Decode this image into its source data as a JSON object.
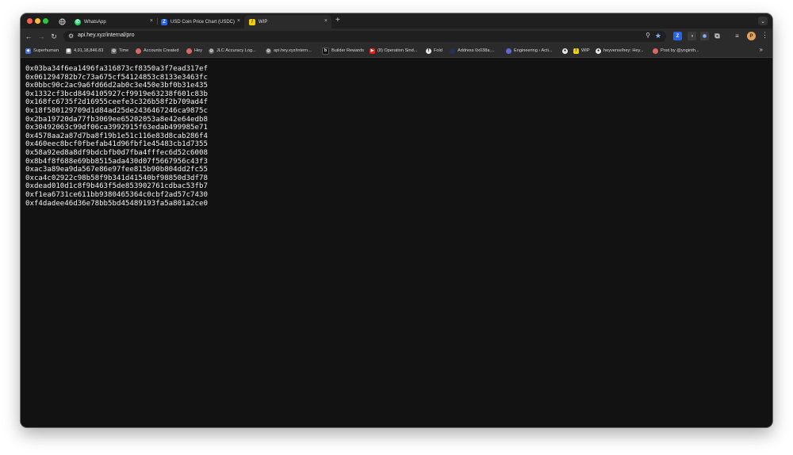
{
  "window": {
    "tabs": [
      {
        "label": "WhatsApp",
        "icon": "whatsapp-icon",
        "color": "#25d366",
        "active": false
      },
      {
        "label": "USD Coin Price Chart (USDC)",
        "icon": "zerion-icon",
        "color": "#2962ef",
        "active": false
      },
      {
        "label": "WIP",
        "icon": "notion-wip-icon",
        "color": "#f5d000",
        "active": true
      }
    ],
    "close_glyph": "×",
    "new_tab_glyph": "+"
  },
  "toolbar": {
    "url": "api.hey.xyz/internal/pro",
    "avatar_letter": "P"
  },
  "bookmarks": [
    {
      "label": "Superhuman",
      "icon": "superhuman-icon"
    },
    {
      "label": "4,91,18,846.83",
      "icon": "sheet-icon"
    },
    {
      "label": "Time",
      "icon": "globe-icon"
    },
    {
      "label": "Accounts Created",
      "icon": "hey-icon"
    },
    {
      "label": "Hey",
      "icon": "hey-icon"
    },
    {
      "label": "JLC Accuracy Log...",
      "icon": "globe-icon"
    },
    {
      "label": "api.hey.xyz/intern...",
      "icon": "globe-icon"
    },
    {
      "label": "Builder Rewards",
      "icon": "builder-icon"
    },
    {
      "label": "(8) Operation Sind...",
      "icon": "youtube-icon"
    },
    {
      "label": "Fold",
      "icon": "fold-icon"
    },
    {
      "label": "Address 0x038a....",
      "icon": "etherscan-icon"
    },
    {
      "label": "Engineering › Acti...",
      "icon": "linear-icon"
    },
    {
      "label": "",
      "icon": "github-icon"
    },
    {
      "label": "WIP",
      "icon": "notion-wip-icon"
    },
    {
      "label": "heyverse/hey: Hey...",
      "icon": "github-icon"
    },
    {
      "label": "Post by @yoginth...",
      "icon": "hey-icon"
    }
  ],
  "content": {
    "addresses": [
      "0x03ba34f6ea1496fa316873cf8350a3f7ead317ef",
      "0x061294782b7c73a675cf54124853c8133e3463fc",
      "0x0bbc90c2ac9a6fd66d2ab0c3e450e3bf0b31e435",
      "0x1332cf3bcd8494105927cf9919e63238f601c83b",
      "0x168fc6735f2d16955ceefe3c326b58f2b709ad4f",
      "0x18f580129709d1d84ad25de2436467246ca9875c",
      "0x2ba19720da77fb3069ee65202053a8e42e64edb8",
      "0x30492063c99df06ca3992915f63edab499985e71",
      "0x4578aa2a87d7ba8f19b1e51c116e83d8cab286f4",
      "0x460eec8bcf0fbefab41d96fbf1e45483cb1d7355",
      "0x58a92ed8a8df9bdcbfb0d7fba4fffec6d52c6008",
      "0x8b4f8f688e69bb8515ada430d07f5667956c43f3",
      "0xac3a89ea9da567e86e97fee815b90b804dd2fc55",
      "0xca4c02922c98b58f9b341d41540bf98850d3df78",
      "0xdead010d1c8f9b463f5de853902761cdbac53fb7",
      "0xf1ea6731ce611bb9380465364c0cbf2ad57c7430",
      "0xf4dadee46d36e78bb5bd45489193fa5a801a2ce0"
    ]
  }
}
